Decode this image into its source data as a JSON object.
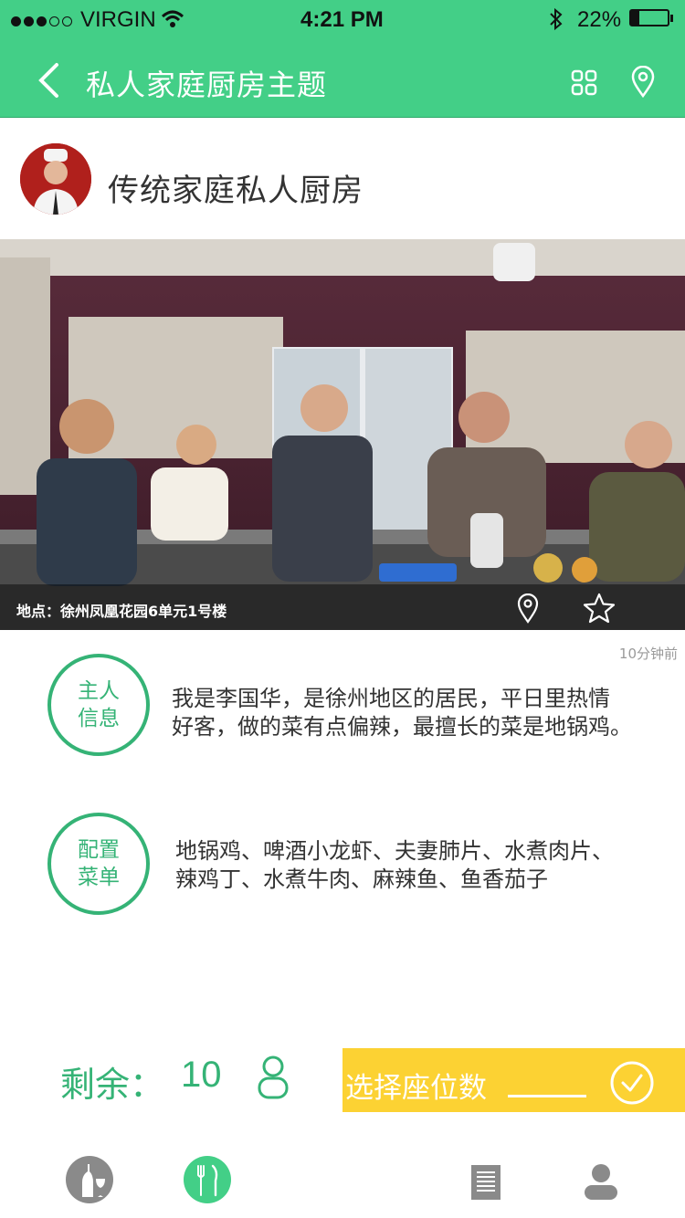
{
  "status_bar": {
    "carrier": "VIRGIN",
    "time": "4:21 PM",
    "battery": "22%"
  },
  "header": {
    "title": "私人家庭厨房主题",
    "back_icon": "chevron-left-icon",
    "grid_icon": "grid-icon",
    "location_icon": "map-pin-icon"
  },
  "host": {
    "kitchen_name": "传统家庭私人厨房"
  },
  "photo": {
    "location": "地点：徐州凤凰花园6单元1号楼",
    "posted": "10分钟前"
  },
  "sections": [
    {
      "badge_line1": "主人",
      "badge_line2": "信息",
      "text_line1": "我是李国华，是徐州地区的居民，平日里热情",
      "text_line2": "好客，做的菜有点偏辣，最擅长的菜是地锅鸡。"
    },
    {
      "badge_line1": "配置",
      "badge_line2": "菜单",
      "text_line1": "地锅鸡、啤酒小龙虾、夫妻肺片、水煮肉片、",
      "text_line2": "辣鸡丁、水煮牛肉、麻辣鱼、鱼香茄子"
    }
  ],
  "booking": {
    "remaining_label": "剩余：",
    "remaining_count": "10",
    "select_label": "选择座位数"
  },
  "colors": {
    "primary_green": "#43cf87",
    "accent_green": "#35b376",
    "yellow": "#fcd233"
  }
}
